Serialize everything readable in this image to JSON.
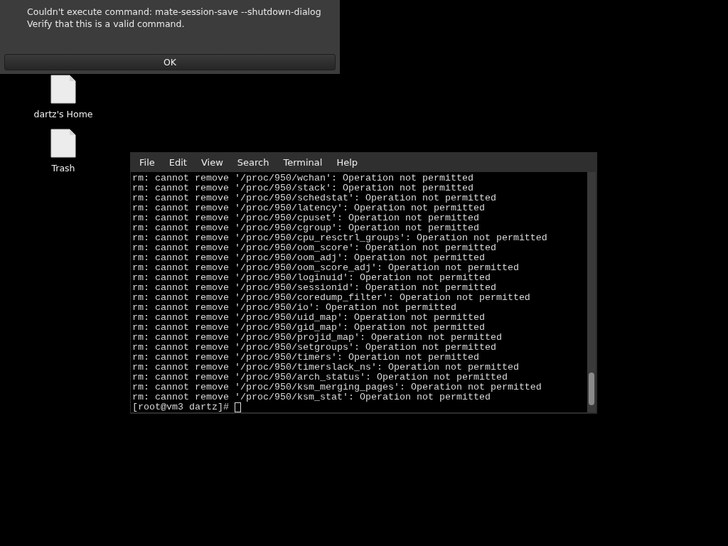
{
  "dialog": {
    "message": [
      "Couldn't execute command: mate-session-save --shutdown-dialog",
      "Verify that this is a valid command."
    ],
    "button": "OK"
  },
  "desktop_icons": [
    {
      "label": "dartz's Home"
    },
    {
      "label": "Trash"
    }
  ],
  "terminal": {
    "menu": [
      "File",
      "Edit",
      "View",
      "Search",
      "Terminal",
      "Help"
    ],
    "lines": [
      "rm: cannot remove '/proc/950/wchan': Operation not permitted",
      "rm: cannot remove '/proc/950/stack': Operation not permitted",
      "rm: cannot remove '/proc/950/schedstat': Operation not permitted",
      "rm: cannot remove '/proc/950/latency': Operation not permitted",
      "rm: cannot remove '/proc/950/cpuset': Operation not permitted",
      "rm: cannot remove '/proc/950/cgroup': Operation not permitted",
      "rm: cannot remove '/proc/950/cpu_resctrl_groups': Operation not permitted",
      "rm: cannot remove '/proc/950/oom_score': Operation not permitted",
      "rm: cannot remove '/proc/950/oom_adj': Operation not permitted",
      "rm: cannot remove '/proc/950/oom_score_adj': Operation not permitted",
      "rm: cannot remove '/proc/950/loginuid': Operation not permitted",
      "rm: cannot remove '/proc/950/sessionid': Operation not permitted",
      "rm: cannot remove '/proc/950/coredump_filter': Operation not permitted",
      "rm: cannot remove '/proc/950/io': Operation not permitted",
      "rm: cannot remove '/proc/950/uid_map': Operation not permitted",
      "rm: cannot remove '/proc/950/gid_map': Operation not permitted",
      "rm: cannot remove '/proc/950/projid_map': Operation not permitted",
      "rm: cannot remove '/proc/950/setgroups': Operation not permitted",
      "rm: cannot remove '/proc/950/timers': Operation not permitted",
      "rm: cannot remove '/proc/950/timerslack_ns': Operation not permitted",
      "rm: cannot remove '/proc/950/arch_status': Operation not permitted",
      "rm: cannot remove '/proc/950/ksm_merging_pages': Operation not permitted",
      "rm: cannot remove '/proc/950/ksm_stat': Operation not permitted"
    ],
    "prompt": "[root@vm3 dartz]#"
  }
}
